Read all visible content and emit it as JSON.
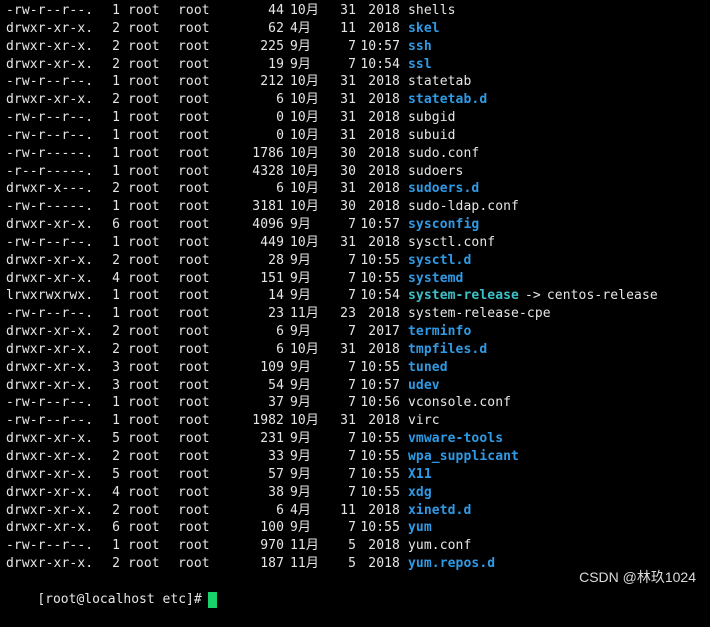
{
  "rows": [
    {
      "perms": "-rw-r--r--.",
      "links": "1",
      "owner": "root",
      "group": "root",
      "size": "44",
      "month": "10月",
      "day": "31",
      "time": "2018",
      "name": "shells",
      "kind": "file"
    },
    {
      "perms": "drwxr-xr-x.",
      "links": "2",
      "owner": "root",
      "group": "root",
      "size": "62",
      "month": "4月",
      "day": "11",
      "time": "2018",
      "name": "skel",
      "kind": "dir"
    },
    {
      "perms": "drwxr-xr-x.",
      "links": "2",
      "owner": "root",
      "group": "root",
      "size": "225",
      "month": "9月",
      "day": "7",
      "time": "10:57",
      "name": "ssh",
      "kind": "dir"
    },
    {
      "perms": "drwxr-xr-x.",
      "links": "2",
      "owner": "root",
      "group": "root",
      "size": "19",
      "month": "9月",
      "day": "7",
      "time": "10:54",
      "name": "ssl",
      "kind": "dir"
    },
    {
      "perms": "-rw-r--r--.",
      "links": "1",
      "owner": "root",
      "group": "root",
      "size": "212",
      "month": "10月",
      "day": "31",
      "time": "2018",
      "name": "statetab",
      "kind": "file"
    },
    {
      "perms": "drwxr-xr-x.",
      "links": "2",
      "owner": "root",
      "group": "root",
      "size": "6",
      "month": "10月",
      "day": "31",
      "time": "2018",
      "name": "statetab.d",
      "kind": "dir"
    },
    {
      "perms": "-rw-r--r--.",
      "links": "1",
      "owner": "root",
      "group": "root",
      "size": "0",
      "month": "10月",
      "day": "31",
      "time": "2018",
      "name": "subgid",
      "kind": "file"
    },
    {
      "perms": "-rw-r--r--.",
      "links": "1",
      "owner": "root",
      "group": "root",
      "size": "0",
      "month": "10月",
      "day": "31",
      "time": "2018",
      "name": "subuid",
      "kind": "file"
    },
    {
      "perms": "-rw-r-----.",
      "links": "1",
      "owner": "root",
      "group": "root",
      "size": "1786",
      "month": "10月",
      "day": "30",
      "time": "2018",
      "name": "sudo.conf",
      "kind": "file"
    },
    {
      "perms": "-r--r-----.",
      "links": "1",
      "owner": "root",
      "group": "root",
      "size": "4328",
      "month": "10月",
      "day": "30",
      "time": "2018",
      "name": "sudoers",
      "kind": "file"
    },
    {
      "perms": "drwxr-x---.",
      "links": "2",
      "owner": "root",
      "group": "root",
      "size": "6",
      "month": "10月",
      "day": "31",
      "time": "2018",
      "name": "sudoers.d",
      "kind": "dir"
    },
    {
      "perms": "-rw-r-----.",
      "links": "1",
      "owner": "root",
      "group": "root",
      "size": "3181",
      "month": "10月",
      "day": "30",
      "time": "2018",
      "name": "sudo-ldap.conf",
      "kind": "file"
    },
    {
      "perms": "drwxr-xr-x.",
      "links": "6",
      "owner": "root",
      "group": "root",
      "size": "4096",
      "month": "9月",
      "day": "7",
      "time": "10:57",
      "name": "sysconfig",
      "kind": "dir"
    },
    {
      "perms": "-rw-r--r--.",
      "links": "1",
      "owner": "root",
      "group": "root",
      "size": "449",
      "month": "10月",
      "day": "31",
      "time": "2018",
      "name": "sysctl.conf",
      "kind": "file"
    },
    {
      "perms": "drwxr-xr-x.",
      "links": "2",
      "owner": "root",
      "group": "root",
      "size": "28",
      "month": "9月",
      "day": "7",
      "time": "10:55",
      "name": "sysctl.d",
      "kind": "dir"
    },
    {
      "perms": "drwxr-xr-x.",
      "links": "4",
      "owner": "root",
      "group": "root",
      "size": "151",
      "month": "9月",
      "day": "7",
      "time": "10:55",
      "name": "systemd",
      "kind": "dir"
    },
    {
      "perms": "lrwxrwxrwx.",
      "links": "1",
      "owner": "root",
      "group": "root",
      "size": "14",
      "month": "9月",
      "day": "7",
      "time": "10:54",
      "name": "system-release",
      "kind": "link",
      "arrow": "->",
      "target": "centos-release"
    },
    {
      "perms": "-rw-r--r--.",
      "links": "1",
      "owner": "root",
      "group": "root",
      "size": "23",
      "month": "11月",
      "day": "23",
      "time": "2018",
      "name": "system-release-cpe",
      "kind": "file"
    },
    {
      "perms": "drwxr-xr-x.",
      "links": "2",
      "owner": "root",
      "group": "root",
      "size": "6",
      "month": "9月",
      "day": "7",
      "time": "2017",
      "name": "terminfo",
      "kind": "dir"
    },
    {
      "perms": "drwxr-xr-x.",
      "links": "2",
      "owner": "root",
      "group": "root",
      "size": "6",
      "month": "10月",
      "day": "31",
      "time": "2018",
      "name": "tmpfiles.d",
      "kind": "dir"
    },
    {
      "perms": "drwxr-xr-x.",
      "links": "3",
      "owner": "root",
      "group": "root",
      "size": "109",
      "month": "9月",
      "day": "7",
      "time": "10:55",
      "name": "tuned",
      "kind": "dir"
    },
    {
      "perms": "drwxr-xr-x.",
      "links": "3",
      "owner": "root",
      "group": "root",
      "size": "54",
      "month": "9月",
      "day": "7",
      "time": "10:57",
      "name": "udev",
      "kind": "dir"
    },
    {
      "perms": "-rw-r--r--.",
      "links": "1",
      "owner": "root",
      "group": "root",
      "size": "37",
      "month": "9月",
      "day": "7",
      "time": "10:56",
      "name": "vconsole.conf",
      "kind": "file"
    },
    {
      "perms": "-rw-r--r--.",
      "links": "1",
      "owner": "root",
      "group": "root",
      "size": "1982",
      "month": "10月",
      "day": "31",
      "time": "2018",
      "name": "virc",
      "kind": "file"
    },
    {
      "perms": "drwxr-xr-x.",
      "links": "5",
      "owner": "root",
      "group": "root",
      "size": "231",
      "month": "9月",
      "day": "7",
      "time": "10:55",
      "name": "vmware-tools",
      "kind": "dir"
    },
    {
      "perms": "drwxr-xr-x.",
      "links": "2",
      "owner": "root",
      "group": "root",
      "size": "33",
      "month": "9月",
      "day": "7",
      "time": "10:55",
      "name": "wpa_supplicant",
      "kind": "dir"
    },
    {
      "perms": "drwxr-xr-x.",
      "links": "5",
      "owner": "root",
      "group": "root",
      "size": "57",
      "month": "9月",
      "day": "7",
      "time": "10:55",
      "name": "X11",
      "kind": "dir"
    },
    {
      "perms": "drwxr-xr-x.",
      "links": "4",
      "owner": "root",
      "group": "root",
      "size": "38",
      "month": "9月",
      "day": "7",
      "time": "10:55",
      "name": "xdg",
      "kind": "dir"
    },
    {
      "perms": "drwxr-xr-x.",
      "links": "2",
      "owner": "root",
      "group": "root",
      "size": "6",
      "month": "4月",
      "day": "11",
      "time": "2018",
      "name": "xinetd.d",
      "kind": "dir"
    },
    {
      "perms": "drwxr-xr-x.",
      "links": "6",
      "owner": "root",
      "group": "root",
      "size": "100",
      "month": "9月",
      "day": "7",
      "time": "10:55",
      "name": "yum",
      "kind": "dir"
    },
    {
      "perms": "-rw-r--r--.",
      "links": "1",
      "owner": "root",
      "group": "root",
      "size": "970",
      "month": "11月",
      "day": "5",
      "time": "2018",
      "name": "yum.conf",
      "kind": "file"
    },
    {
      "perms": "drwxr-xr-x.",
      "links": "2",
      "owner": "root",
      "group": "root",
      "size": "187",
      "month": "11月",
      "day": "5",
      "time": "2018",
      "name": "yum.repos.d",
      "kind": "dir"
    }
  ],
  "prompt": "[root@localhost etc]#",
  "watermark": "CSDN @林玖1024",
  "colors": {
    "background": "#000000",
    "text": "#e6e6e6",
    "directory": "#2f9be6",
    "symlink": "#3cc2c7",
    "cursor": "#19d36a"
  }
}
